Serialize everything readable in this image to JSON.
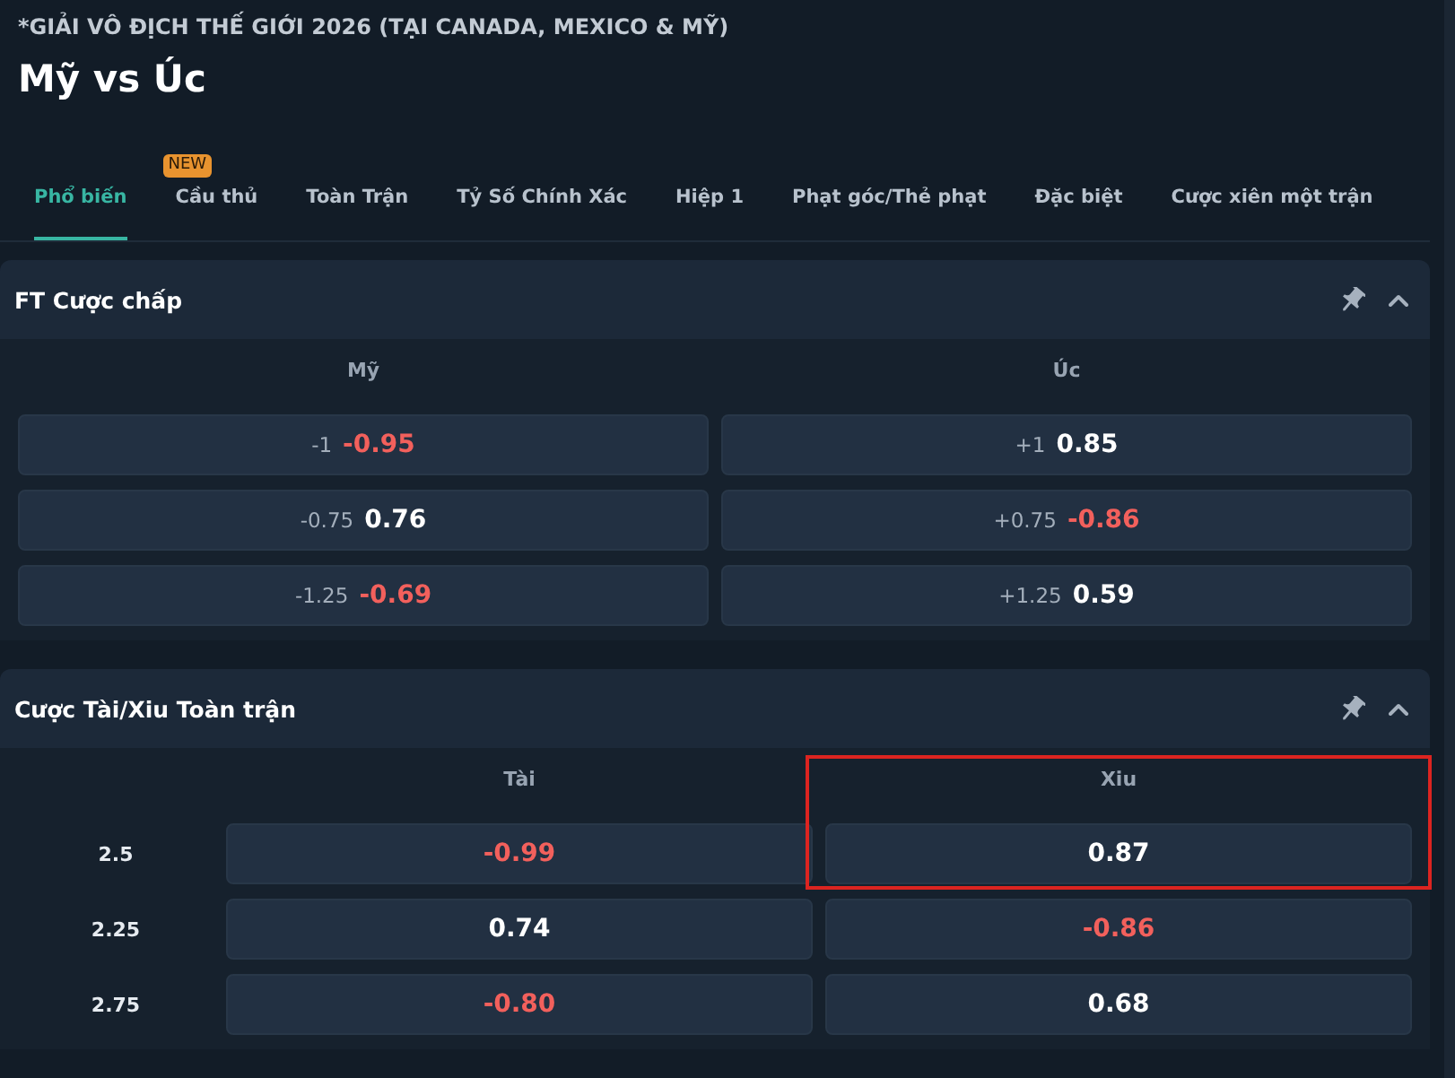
{
  "league": "*GIẢI VÔ ĐỊCH THẾ GIỚI 2026 (TẠI CANADA, MEXICO & MỸ)",
  "match": "Mỹ vs Úc",
  "tabs": [
    {
      "label": "Phổ biến",
      "selected": true
    },
    {
      "label": "Cầu thủ",
      "selected": false,
      "badge": "NEW"
    },
    {
      "label": "Toàn Trận",
      "selected": false
    },
    {
      "label": "Tỷ Số Chính Xác",
      "selected": false
    },
    {
      "label": "Hiệp 1",
      "selected": false
    },
    {
      "label": "Phạt góc/Thẻ phạt",
      "selected": false
    },
    {
      "label": "Đặc biệt",
      "selected": false
    },
    {
      "label": "Cược xiên một trận",
      "selected": false
    }
  ],
  "markets": [
    {
      "kind": "handicap",
      "title": "FT Cược chấp",
      "columns": [
        {
          "label": "Mỹ"
        },
        {
          "label": "Úc"
        }
      ],
      "rows": [
        {
          "cells": [
            {
              "line": "-1",
              "odds": "-0.95",
              "negative": true,
              "outlined": false
            },
            {
              "line": "+1",
              "odds": "0.85",
              "negative": false,
              "outlined": false
            }
          ]
        },
        {
          "cells": [
            {
              "line": "-0.75",
              "odds": "0.76",
              "negative": false,
              "outlined": false
            },
            {
              "line": "+0.75",
              "odds": "-0.86",
              "negative": true,
              "outlined": false
            }
          ]
        },
        {
          "cells": [
            {
              "line": "-1.25",
              "odds": "-0.69",
              "negative": true,
              "outlined": false
            },
            {
              "line": "+1.25",
              "odds": "0.59",
              "negative": false,
              "outlined": false
            }
          ]
        }
      ]
    },
    {
      "kind": "total",
      "title": "Cược Tài/Xiu Toàn trận",
      "columns": [
        {
          "label": "Tài"
        },
        {
          "label": "Xiu"
        }
      ],
      "rows": [
        {
          "line": "2.5",
          "cells": [
            {
              "odds": "-0.99",
              "negative": true,
              "outlined": false
            },
            {
              "odds": "0.87",
              "negative": false,
              "outlined": true
            }
          ]
        },
        {
          "line": "2.25",
          "cells": [
            {
              "odds": "0.74",
              "negative": false,
              "outlined": false
            },
            {
              "odds": "-0.86",
              "negative": true,
              "outlined": false
            }
          ]
        },
        {
          "line": "2.75",
          "cells": [
            {
              "odds": "-0.80",
              "negative": true,
              "outlined": false
            },
            {
              "odds": "0.68",
              "negative": false,
              "outlined": false
            }
          ]
        }
      ]
    }
  ]
}
